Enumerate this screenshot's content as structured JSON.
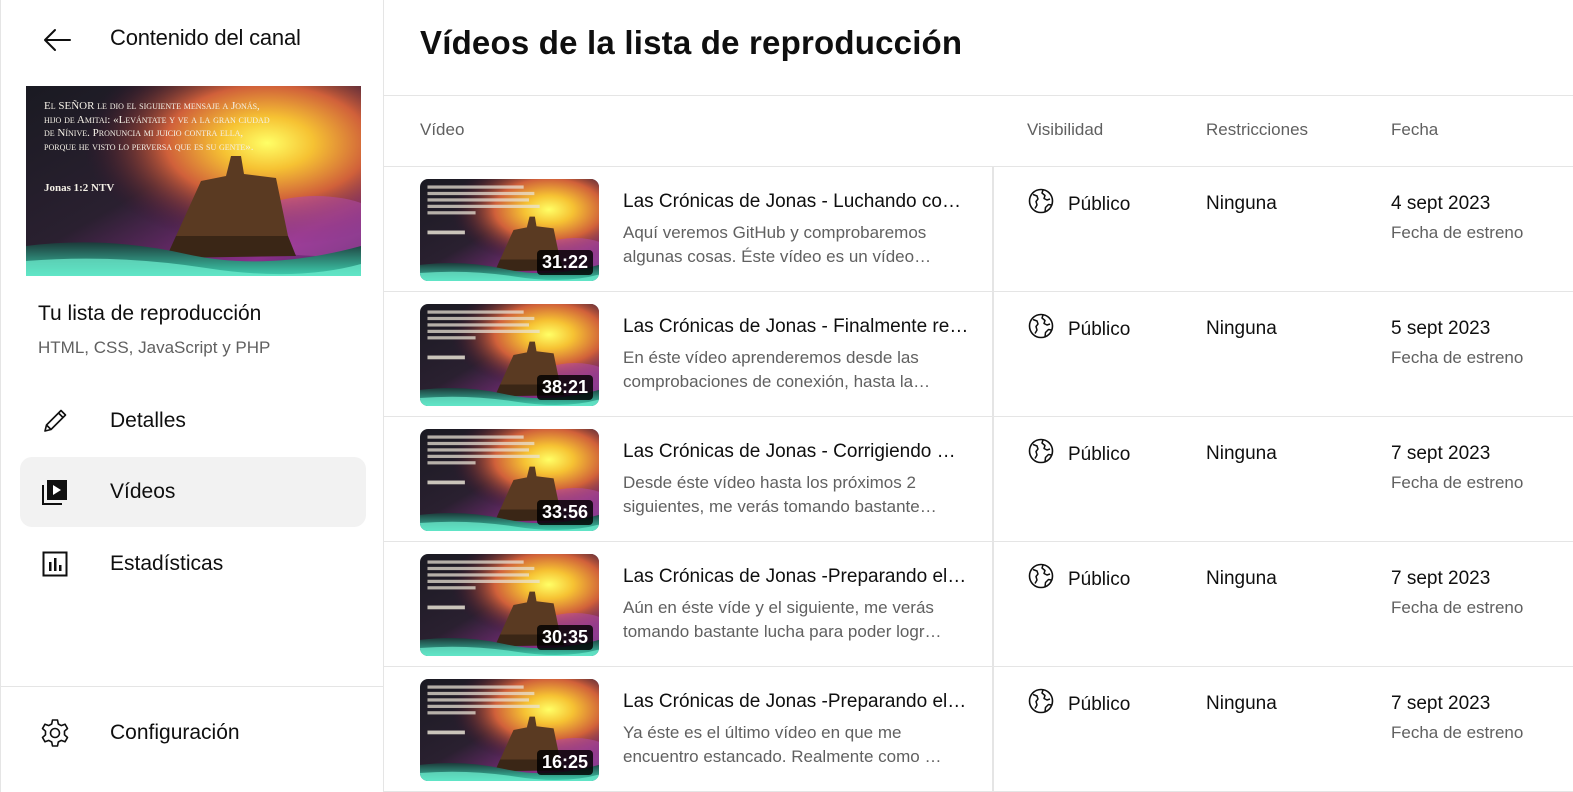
{
  "sidebar": {
    "title": "Contenido del canal",
    "playlist": {
      "cover_text": "El SEÑOR le dio el siguiente mensaje a Jonás, hijo de Amitai: «Levántate y ve a la gran ciudad de Nínive. Pronuncia mi juicio contra ella, porque he visto lo perversa que es su gente».",
      "cover_ref": "Jonas 1:2 NTV",
      "name": "Tu lista de reproducción",
      "description": "HTML, CSS, JavaScript y PHP"
    },
    "nav": [
      {
        "label": "Detalles",
        "icon": "pencil-icon"
      },
      {
        "label": "Vídeos",
        "icon": "video-library-icon",
        "active": true
      },
      {
        "label": "Estadísticas",
        "icon": "analytics-icon"
      }
    ],
    "settings_label": "Configuración"
  },
  "main": {
    "title": "Vídeos de la lista de reproducción",
    "columns": {
      "video": "Vídeo",
      "visibility": "Visibilidad",
      "restrictions": "Restricciones",
      "date": "Fecha"
    },
    "rows": [
      {
        "title": "Las Crónicas de Jonas - Luchando co…",
        "description": "Aquí veremos GitHub y comprobaremos algunas cosas. Éste vídeo es un vídeo…",
        "duration": "31:22",
        "visibility": "Público",
        "restrictions": "Ninguna",
        "date": "4 sept 2023",
        "date_type": "Fecha de estreno"
      },
      {
        "title": "Las Crónicas de Jonas - Finalmente re…",
        "description": "En éste vídeo aprenderemos desde las comprobaciones de conexión, hasta la…",
        "duration": "38:21",
        "visibility": "Público",
        "restrictions": "Ninguna",
        "date": "5 sept 2023",
        "date_type": "Fecha de estreno"
      },
      {
        "title": "Las Crónicas de Jonas - Corrigiendo …",
        "description": "Desde éste vídeo hasta los próximos 2 siguientes, me verás tomando bastante…",
        "duration": "33:56",
        "visibility": "Público",
        "restrictions": "Ninguna",
        "date": "7 sept 2023",
        "date_type": "Fecha de estreno"
      },
      {
        "title": "Las Crónicas de Jonas -Preparando el…",
        "description": "Aún en éste víde y el siguiente, me verás tomando bastante lucha para poder logr…",
        "duration": "30:35",
        "visibility": "Público",
        "restrictions": "Ninguna",
        "date": "7 sept 2023",
        "date_type": "Fecha de estreno"
      },
      {
        "title": "Las Crónicas de Jonas -Preparando el…",
        "description": "Ya éste es el último vídeo en que me encuentro estancado. Realmente como …",
        "duration": "16:25",
        "visibility": "Público",
        "restrictions": "Ninguna",
        "date": "7 sept 2023",
        "date_type": "Fecha de estreno"
      }
    ]
  }
}
